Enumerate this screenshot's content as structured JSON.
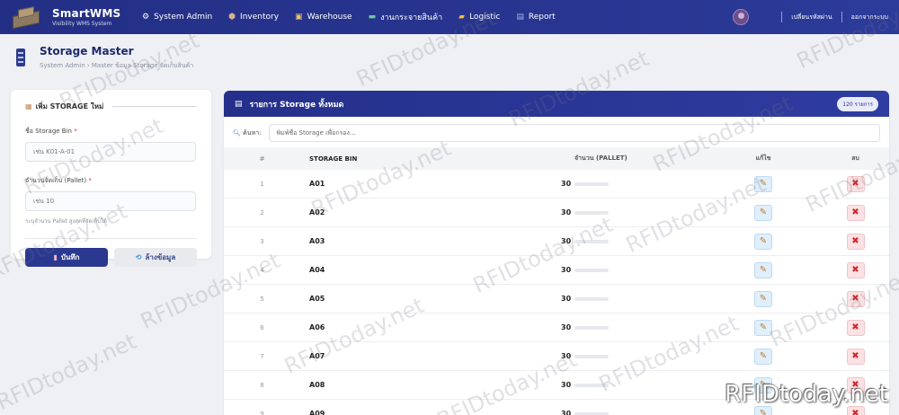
{
  "navbar": {
    "brand_name": "SmartWMS",
    "brand_sub": "Visibility WMS System",
    "menu": [
      {
        "label": "System Admin",
        "icon": "gear-icon"
      },
      {
        "label": "Inventory",
        "icon": "box-icon"
      },
      {
        "label": "Warehouse",
        "icon": "warehouse-icon"
      },
      {
        "label": "งานกระจายสินค้า",
        "icon": "truck-icon"
      },
      {
        "label": "Logistic",
        "icon": "truck-icon"
      },
      {
        "label": "Report",
        "icon": "report-icon"
      }
    ],
    "change_password": "เปลี่ยนรหัสผ่าน",
    "logout": "ออกจากระบบ"
  },
  "page": {
    "title": "Storage Master",
    "breadcrumb": "System Admin › Master ข้อมูล Storage จัดเก็บสินค้า"
  },
  "form": {
    "heading": "เพิ่ม STORAGE ใหม่",
    "bin_label": "ชื่อ Storage Bin",
    "bin_placeholder": "เช่น K01-A-01",
    "capacity_label": "จำนวนจัดเก็บ (Pallet)",
    "capacity_placeholder": "เช่น 10",
    "hint": "ระบุจำนวน Pallet สูงสุดที่จัดเก็บได้",
    "required_mark": "*",
    "save_label": "บันทึก",
    "clear_label": "ล้างข้อมูล"
  },
  "table": {
    "title": "รายการ Storage ทั้งหมด",
    "count_badge": "120 รายการ",
    "search_label": "ค้นหา:",
    "search_placeholder": "พิมพ์ชื่อ Storage เพื่อกรอง...",
    "headers": {
      "num": "#",
      "bin": "STORAGE BIN",
      "qty": "จำนวน (PALLET)",
      "edit": "แก้ไข",
      "del": "ลบ"
    },
    "rows": [
      {
        "num": "1",
        "bin": "A01",
        "qty": "30"
      },
      {
        "num": "2",
        "bin": "A02",
        "qty": "30"
      },
      {
        "num": "3",
        "bin": "A03",
        "qty": "30"
      },
      {
        "num": "4",
        "bin": "A04",
        "qty": "30"
      },
      {
        "num": "5",
        "bin": "A05",
        "qty": "30"
      },
      {
        "num": "6",
        "bin": "A06",
        "qty": "30"
      },
      {
        "num": "7",
        "bin": "A07",
        "qty": "30"
      },
      {
        "num": "8",
        "bin": "A08",
        "qty": "30"
      },
      {
        "num": "9",
        "bin": "A09",
        "qty": "30"
      }
    ]
  },
  "watermark": {
    "text": "RFIDtoday.net"
  },
  "colors": {
    "primary": "#2b3890",
    "edit": "#dfeffb",
    "delete": "#d3262e"
  }
}
